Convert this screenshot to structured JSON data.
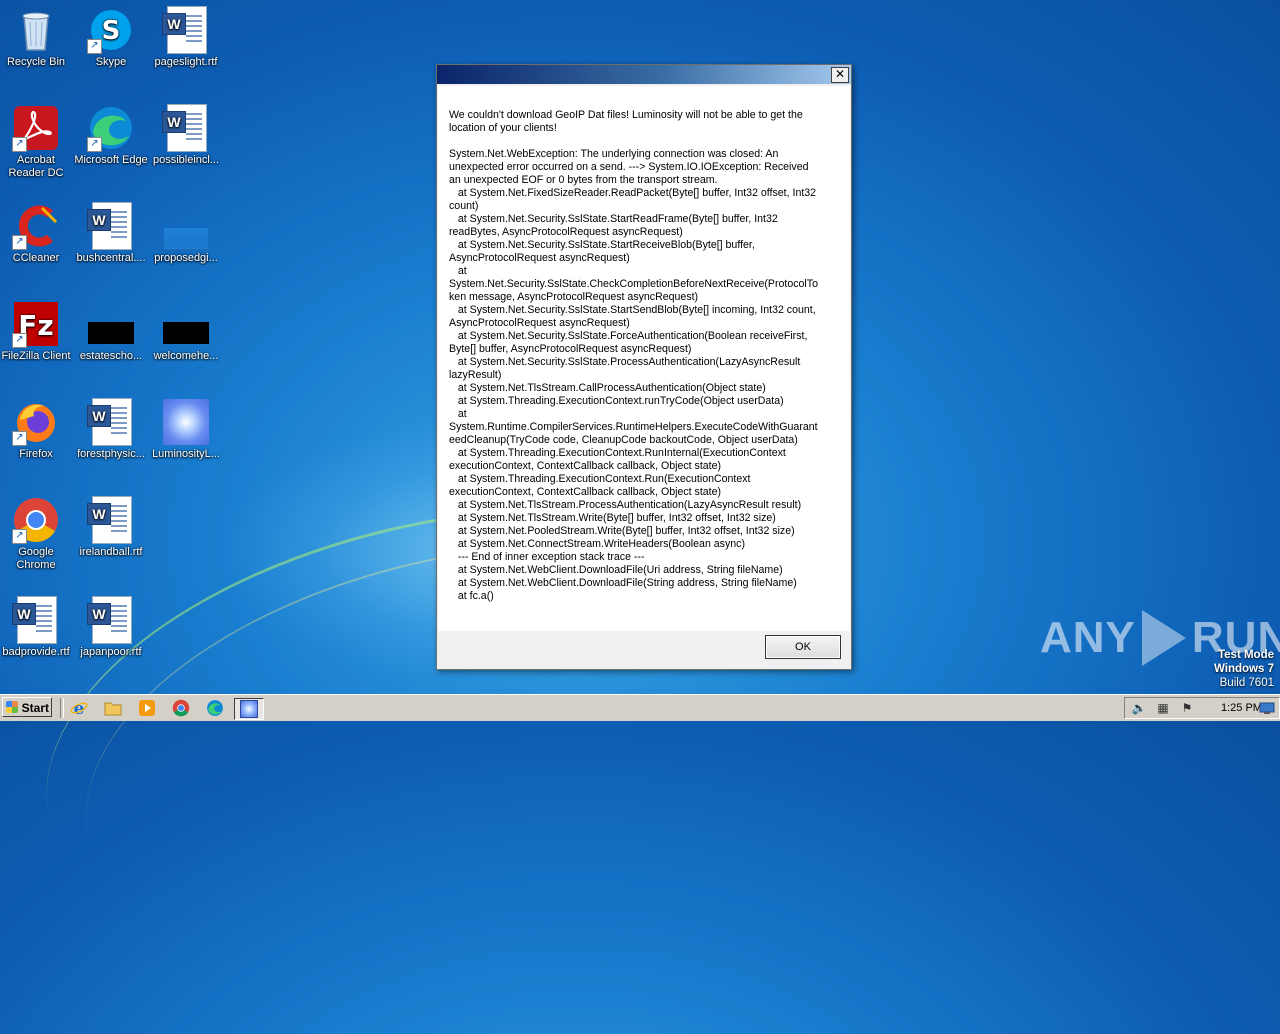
{
  "desktop": {
    "icons": [
      {
        "label": "Recycle Bin",
        "icon": "recycle-bin-icon"
      },
      {
        "label": "Skype",
        "icon": "skype-icon"
      },
      {
        "label": "pageslight.rtf",
        "icon": "word-document-icon"
      },
      {
        "label": "Acrobat Reader DC",
        "icon": "acrobat-icon"
      },
      {
        "label": "Microsoft Edge",
        "icon": "edge-icon"
      },
      {
        "label": "possibleincl...",
        "icon": "word-document-icon"
      },
      {
        "label": "CCleaner",
        "icon": "ccleaner-icon"
      },
      {
        "label": "bushcentral....",
        "icon": "word-document-icon"
      },
      {
        "label": "proposedgi...",
        "icon": "blank-file-icon"
      },
      {
        "label": "FileZilla Client",
        "icon": "filezilla-icon"
      },
      {
        "label": "estatescho...",
        "icon": "black-file-icon"
      },
      {
        "label": "welcomehe...",
        "icon": "black-file-icon"
      },
      {
        "label": "Firefox",
        "icon": "firefox-icon"
      },
      {
        "label": "forestphysic...",
        "icon": "word-document-icon"
      },
      {
        "label": "LuminosityL...",
        "icon": "luminosity-icon"
      },
      {
        "label": "Google Chrome",
        "icon": "chrome-icon"
      },
      {
        "label": "irelandball.rtf",
        "icon": "word-document-icon"
      },
      {
        "label": "badprovide.rtf",
        "icon": "word-document-icon"
      },
      {
        "label": "japanpoor.rtf",
        "icon": "word-document-icon"
      }
    ]
  },
  "dialog": {
    "title": "",
    "close_symbol": "✕",
    "message": "We couldn't download GeoIP Dat files! Luminosity will not be able to get the location of your clients!\n\nSystem.Net.WebException: The underlying connection was closed: An unexpected error occurred on a send. ---> System.IO.IOException: Received an unexpected EOF or 0 bytes from the transport stream.\n   at System.Net.FixedSizeReader.ReadPacket(Byte[] buffer, Int32 offset, Int32 count)\n   at System.Net.Security.SslState.StartReadFrame(Byte[] buffer, Int32 readBytes, AsyncProtocolRequest asyncRequest)\n   at System.Net.Security.SslState.StartReceiveBlob(Byte[] buffer, AsyncProtocolRequest asyncRequest)\n   at\nSystem.Net.Security.SslState.CheckCompletionBeforeNextReceive(ProtocolToken message, AsyncProtocolRequest asyncRequest)\n   at System.Net.Security.SslState.StartSendBlob(Byte[] incoming, Int32 count, AsyncProtocolRequest asyncRequest)\n   at System.Net.Security.SslState.ForceAuthentication(Boolean receiveFirst, Byte[] buffer, AsyncProtocolRequest asyncRequest)\n   at System.Net.Security.SslState.ProcessAuthentication(LazyAsyncResult lazyResult)\n   at System.Net.TlsStream.CallProcessAuthentication(Object state)\n   at System.Threading.ExecutionContext.runTryCode(Object userData)\n   at\nSystem.Runtime.CompilerServices.RuntimeHelpers.ExecuteCodeWithGuaranteedCleanup(TryCode code, CleanupCode backoutCode, Object userData)\n   at System.Threading.ExecutionContext.RunInternal(ExecutionContext executionContext, ContextCallback callback, Object state)\n   at System.Threading.ExecutionContext.Run(ExecutionContext executionContext, ContextCallback callback, Object state)\n   at System.Net.TlsStream.ProcessAuthentication(LazyAsyncResult result)\n   at System.Net.TlsStream.Write(Byte[] buffer, Int32 offset, Int32 size)\n   at System.Net.PooledStream.Write(Byte[] buffer, Int32 offset, Int32 size)\n   at System.Net.ConnectStream.WriteHeaders(Boolean async)\n   --- End of inner exception stack trace ---\n   at System.Net.WebClient.DownloadFile(Uri address, String fileName)\n   at System.Net.WebClient.DownloadFile(String address, String fileName)\n   at fc.a()",
    "ok_label": "OK"
  },
  "watermark": {
    "left": "ANY",
    "right": "RUN"
  },
  "os_notice": {
    "line1": "Test Mode",
    "line2": "Windows 7",
    "line3": "Build 7601"
  },
  "taskbar": {
    "start_label": "Start",
    "quick_launch": [
      "ie-icon",
      "explorer-icon",
      "media-player-icon",
      "chrome-icon",
      "edge-icon",
      "luminosity-app-icon"
    ],
    "tray_icons": [
      "speaker-icon",
      "network-icon",
      "action-center-flag-icon",
      "show-desktop-icon"
    ],
    "clock": "1:25 PM"
  },
  "colors": {
    "desktop_bg": "#1a7fd0",
    "dialog_titlebar_start": "#0a246a",
    "dialog_titlebar_end": "#a6caf0",
    "taskbar_bg": "#d4d0c8"
  }
}
